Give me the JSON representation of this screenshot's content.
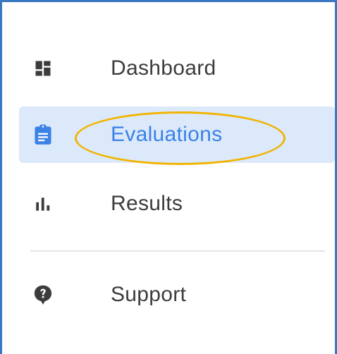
{
  "nav": {
    "items": [
      {
        "label": "Dashboard",
        "icon": "dashboard-icon",
        "active": false
      },
      {
        "label": "Evaluations",
        "icon": "clipboard-icon",
        "active": true
      },
      {
        "label": "Results",
        "icon": "bar-chart-icon",
        "active": false
      },
      {
        "label": "Support",
        "icon": "help-icon",
        "active": false
      }
    ]
  },
  "colors": {
    "frame_border": "#3a77c3",
    "active_background": "#dce9fb",
    "active_text": "#3b82e6",
    "text": "#3c3c3c",
    "icon": "#3c3c3c",
    "highlight": "#f2b400",
    "divider": "#e3e3e3"
  }
}
